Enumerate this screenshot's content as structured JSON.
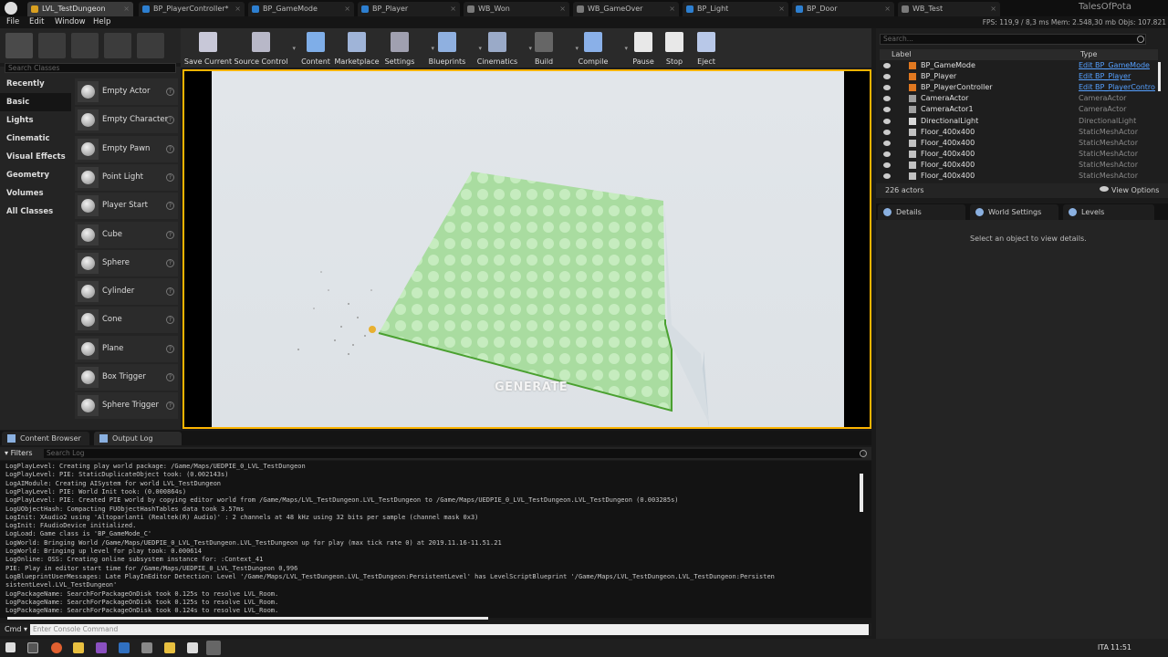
{
  "tabs": [
    {
      "label": "LVL_TestDungeon",
      "color": "#d9a020"
    },
    {
      "label": "BP_PlayerController*",
      "color": "#2d7fd0"
    },
    {
      "label": "BP_GameMode",
      "color": "#2d7fd0"
    },
    {
      "label": "BP_Player",
      "color": "#2d7fd0"
    },
    {
      "label": "WB_Won",
      "color": "#7a7a7a"
    },
    {
      "label": "WB_GameOver",
      "color": "#7a7a7a"
    },
    {
      "label": "BP_Light",
      "color": "#2d7fd0"
    },
    {
      "label": "BP_Door",
      "color": "#2d7fd0"
    },
    {
      "label": "WB_Test",
      "color": "#7a7a7a"
    }
  ],
  "brand": "TalesOfPota",
  "menu": [
    "File",
    "Edit",
    "Window",
    "Help"
  ],
  "stats": "FPS: 119,9 / 8,3 ms  Mem: 2.548,30 mb  Objs: 107.821",
  "place": {
    "search_placeholder": "Search Classes",
    "categories": [
      "Recently Placed",
      "Basic",
      "Lights",
      "Cinematic",
      "Visual Effects",
      "Geometry",
      "Volumes",
      "All Classes"
    ],
    "items": [
      "Empty Actor",
      "Empty Character",
      "Empty Pawn",
      "Point Light",
      "Player Start",
      "Cube",
      "Sphere",
      "Cylinder",
      "Cone",
      "Plane",
      "Box Trigger",
      "Sphere Trigger"
    ]
  },
  "toolbar": [
    {
      "label": "Save Current",
      "icon": "save-icon",
      "color": "#c8c8d8",
      "dropdown": false
    },
    {
      "label": "Source Control",
      "icon": "source-control-icon",
      "color": "#b8b8c8",
      "dropdown": true
    },
    {
      "label": "Content",
      "icon": "content-icon",
      "color": "#7faee8",
      "dropdown": false
    },
    {
      "label": "Marketplace",
      "icon": "marketplace-icon",
      "color": "#9fb4d8",
      "dropdown": false
    },
    {
      "label": "Settings",
      "icon": "settings-icon",
      "color": "#a0a0b0",
      "dropdown": true
    },
    {
      "label": "Blueprints",
      "icon": "blueprints-icon",
      "color": "#8fb0e0",
      "dropdown": true
    },
    {
      "label": "Cinematics",
      "icon": "cinematics-icon",
      "color": "#9aaac8",
      "dropdown": true
    },
    {
      "label": "Build",
      "icon": "build-icon",
      "color": "#666666",
      "dropdown": true
    },
    {
      "label": "Compile",
      "icon": "compile-icon",
      "color": "#8ab0e8",
      "dropdown": true
    },
    {
      "label": "Pause",
      "icon": "pause-icon",
      "color": "#e8e8e8",
      "dropdown": false
    },
    {
      "label": "Stop",
      "icon": "stop-icon",
      "color": "#e8e8e8",
      "dropdown": false
    },
    {
      "label": "Eject",
      "icon": "eject-icon",
      "color": "#b8c8e8",
      "dropdown": false
    }
  ],
  "viewport": {
    "button": "GENERATE"
  },
  "outliner": {
    "search_placeholder": "Search...",
    "col_label": "Label",
    "col_type": "Type",
    "rows": [
      {
        "label": "BP_GameMode",
        "type": "Edit BP_GameMode",
        "link": true,
        "icon": "#e07820"
      },
      {
        "label": "BP_Player",
        "type": "Edit BP_Player",
        "link": true,
        "icon": "#e07820"
      },
      {
        "label": "BP_PlayerController",
        "type": "Edit BP_PlayerContro",
        "link": true,
        "icon": "#e07820"
      },
      {
        "label": "CameraActor",
        "type": "CameraActor",
        "link": false,
        "icon": "#a0a0a0"
      },
      {
        "label": "CameraActor1",
        "type": "CameraActor",
        "link": false,
        "icon": "#a0a0a0"
      },
      {
        "label": "DirectionalLight",
        "type": "DirectionalLight",
        "link": false,
        "icon": "#d8d8d8"
      },
      {
        "label": "Floor_400x400",
        "type": "StaticMeshActor",
        "link": false,
        "icon": "#c0c0c0"
      },
      {
        "label": "Floor_400x400",
        "type": "StaticMeshActor",
        "link": false,
        "icon": "#c0c0c0"
      },
      {
        "label": "Floor_400x400",
        "type": "StaticMeshActor",
        "link": false,
        "icon": "#c0c0c0"
      },
      {
        "label": "Floor_400x400",
        "type": "StaticMeshActor",
        "link": false,
        "icon": "#c0c0c0"
      },
      {
        "label": "Floor_400x400",
        "type": "StaticMeshActor",
        "link": false,
        "icon": "#c0c0c0"
      }
    ],
    "count": "226 actors",
    "view_options": "View Options"
  },
  "details": {
    "tabs": [
      "Details",
      "World Settings",
      "Levels"
    ],
    "message": "Select an object to view details."
  },
  "bottom": {
    "tabs": [
      "Content Browser",
      "Output Log"
    ],
    "filters": "Filters",
    "search_placeholder": "Search Log",
    "cmd_label": "Cmd",
    "cmd_placeholder": "Enter Console Command"
  },
  "log": [
    "LogPlayLevel: Creating play world package: /Game/Maps/UEDPIE_0_LVL_TestDungeon",
    "LogPlayLevel: PIE: StaticDuplicateObject took: (0.002143s)",
    "LogAIModule: Creating AISystem for world LVL_TestDungeon",
    "LogPlayLevel: PIE: World Init took: (0.000864s)",
    "LogPlayLevel: PIE: Created PIE world by copying editor world from /Game/Maps/LVL_TestDungeon.LVL_TestDungeon to /Game/Maps/UEDPIE_0_LVL_TestDungeon.LVL_TestDungeon (0.003285s)",
    "LogUObjectHash: Compacting FUObjectHashTables data took   3.57ms",
    "LogInit: XAudio2 using 'Altoparlanti (Realtek(R) Audio)' : 2 channels at 48 kHz using 32 bits per sample (channel mask 0x3)",
    "LogInit: FAudioDevice initialized.",
    "LogLoad: Game class is 'BP_GameMode_C'",
    "LogWorld: Bringing World /Game/Maps/UEDPIE_0_LVL_TestDungeon.LVL_TestDungeon up for play (max tick rate 0) at 2019.11.16-11.51.21",
    "LogWorld: Bringing up level for play took: 0.000614",
    "LogOnline: OSS: Creating online subsystem instance for: :Context_41",
    "PIE: Play in editor start time for /Game/Maps/UEDPIE_0_LVL_TestDungeon 0,996",
    "LogBlueprintUserMessages: Late PlayInEditor Detection: Level '/Game/Maps/LVL_TestDungeon.LVL_TestDungeon:PersistentLevel' has LevelScriptBlueprint '/Game/Maps/LVL_TestDungeon.LVL_TestDungeon:Persisten",
    "sistentLevel.LVL_TestDungeon'",
    "LogPackageName: SearchForPackageOnDisk took   0.125s to resolve LVL_Room.",
    "LogPackageName: SearchForPackageOnDisk took   0.125s to resolve LVL_Room.",
    "LogPackageName: SearchForPackageOnDisk took   0.124s to resolve LVL_Room."
  ],
  "taskbar": {
    "lang": "ITA",
    "time": "11:51"
  }
}
